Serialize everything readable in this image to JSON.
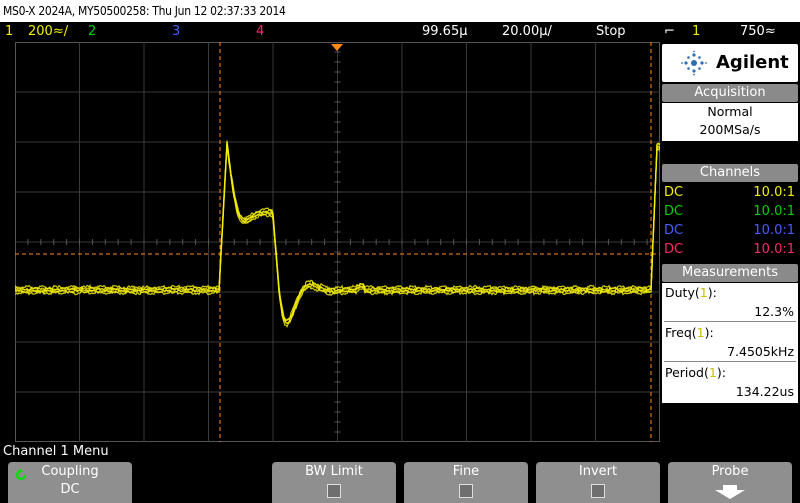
{
  "title_bar": "MS0-X 2024A, MY50500258: Thu Jun 12 02:37:33 2014",
  "status": {
    "ch1_num": "1",
    "ch1_scale": "200≈/",
    "ch2_num": "2",
    "ch3_num": "3",
    "ch4_num": "4",
    "time_offset": "99.65µ",
    "time_scale": "20.00µ/",
    "run_state": "Stop",
    "trigger_slope": "⽯",
    "trigger_source": "1",
    "trigger_level": "750≈"
  },
  "brand": "Agilent",
  "acquisition": {
    "header": "Acquisition",
    "mode": "Normal",
    "rate": "200MSa/s"
  },
  "channels": {
    "header": "Channels",
    "rows": [
      {
        "coupling": "DC",
        "probe": "10.0:1",
        "color": "#f5ee00"
      },
      {
        "coupling": "DC",
        "probe": "10.0:1",
        "color": "#00d000"
      },
      {
        "coupling": "DC",
        "probe": "10.0:1",
        "color": "#4a5cff"
      },
      {
        "coupling": "DC",
        "probe": "10.0:1",
        "color": "#ff2a6a"
      }
    ]
  },
  "measurements": {
    "header": "Measurements",
    "items": [
      {
        "label": "Duty",
        "channel": "1",
        "value": "12.3%"
      },
      {
        "label": "Freq",
        "channel": "1",
        "value": "7.4505kHz"
      },
      {
        "label": "Period",
        "channel": "1",
        "value": "134.22us"
      }
    ]
  },
  "menu": {
    "title": "Channel 1 Menu",
    "coupling_label": "Coupling",
    "coupling_value": "DC",
    "bw_limit_label": "BW Limit",
    "fine_label": "Fine",
    "invert_label": "Invert",
    "probe_label": "Probe"
  },
  "screen_markers": {
    "trigger_marker": "T",
    "ground_marker": "1"
  },
  "colors": {
    "ch1": "#f5ee00",
    "cursor": "#ff8a1a",
    "grid": "#3a3a3a"
  }
}
